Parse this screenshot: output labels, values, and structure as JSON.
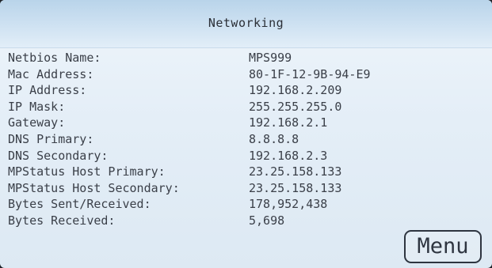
{
  "screen": {
    "title": "Networking"
  },
  "fields": [
    {
      "label": "Netbios Name:",
      "value": "MPS999"
    },
    {
      "label": "Mac Address:",
      "value": "80-1F-12-9B-94-E9"
    },
    {
      "label": "IP Address:",
      "value": "192.168.2.209"
    },
    {
      "label": "IP Mask:",
      "value": "255.255.255.0"
    },
    {
      "label": "Gateway:",
      "value": "192.168.2.1"
    },
    {
      "label": "DNS Primary:",
      "value": "8.8.8.8"
    },
    {
      "label": "DNS Secondary:",
      "value": "192.168.2.3"
    },
    {
      "label": "MPStatus Host Primary:",
      "value": "23.25.158.133"
    },
    {
      "label": "MPStatus Host Secondary:",
      "value": "23.25.158.133"
    },
    {
      "label": "Bytes Sent/Received:",
      "value": "178,952,438"
    },
    {
      "label": "Bytes Received:",
      "value": "5,698"
    }
  ],
  "menu_button": {
    "label": "Menu"
  }
}
